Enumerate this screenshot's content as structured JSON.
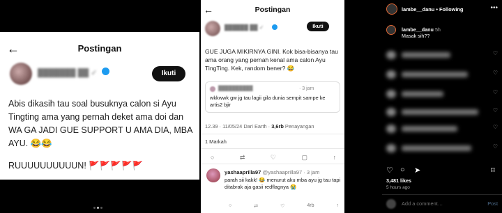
{
  "left_post": {
    "header_title": "Postingan",
    "back_icon": "arrow-left-icon",
    "follow_label": "Ikuti",
    "body_text": "Abis dikasih tau soal busuknya calon si Ayu Tingting ama yang pernah deket ama doi dan WA GA JADI GUE SUPPORT U AMA DIA, MBA AYU. 😂😂",
    "body_text_2": "RUUUUUUUUUUN! 🚩🚩🚩🚩🚩"
  },
  "middle_post": {
    "header_title": "Postingan",
    "back_icon": "arrow-left-icon",
    "follow_label": "Ikuti",
    "body_text": "GUE JUGA MIKIRNYA GINI. Kok bisa-bisanya tau ama orang yang pernah kenal ama calon Ayu TingTing. Kek, random bener? 😂",
    "quote": {
      "time": "· 3 jam",
      "text": "wkkwwk gw jg tau lagii gila dunia sempit sampe ke artis2 bjir"
    },
    "meta": {
      "timestamp": "12.39 · 11/05/24 Dari Earth ·",
      "views": "3,6rb",
      "views_label": "Penayangan"
    },
    "likes": "1 Markah",
    "actions": [
      "reply-icon",
      "retweet-icon",
      "like-icon",
      "bookmark-icon",
      "share-icon"
    ],
    "reply": {
      "name": "yashaaprilla97",
      "handle": "@yashaaprilla97 · 3 jam",
      "text": "parah sii kakk! 😂 menurut aku mba ayu jg tau tapi ditabrak aja gasii redflagnya 😭",
      "views": "4rb"
    }
  },
  "instagram": {
    "account": "lambe__danu",
    "follow_status": "• Following",
    "more_icon": "more-icon",
    "first_comment": {
      "name": "lambe__danu",
      "time": "5h",
      "text": "Masak sih??"
    },
    "like_count": "3,481 likes",
    "time_ago": "5 hours ago",
    "comment_placeholder": "Add a comment…",
    "post_label": "Post",
    "action_icons": [
      "heart-icon",
      "comment-icon",
      "send-icon",
      "save-icon"
    ]
  }
}
